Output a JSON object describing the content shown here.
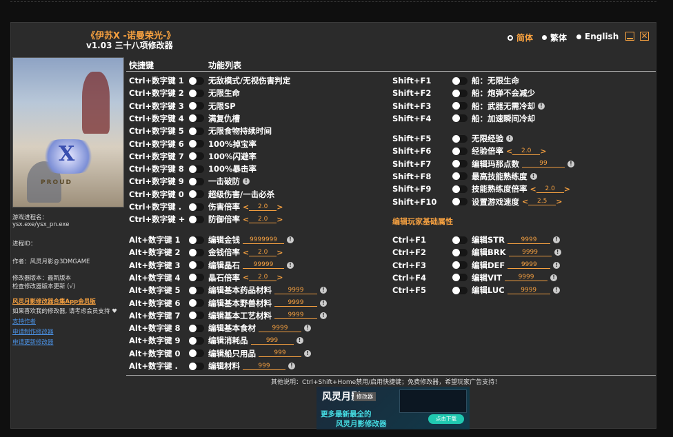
{
  "title": "《伊苏X -诺曼荣光-》",
  "subtitle": "v1.03 三十八项修改器",
  "languages": [
    {
      "label": "简体",
      "selected": true
    },
    {
      "label": "繁体",
      "selected": false
    },
    {
      "label": "English",
      "selected": false
    }
  ],
  "cover": {
    "logo_letter": "X",
    "logo_word": "PROUD"
  },
  "sidebar": {
    "process_label": "游戏进程名：",
    "process_value": "ysx.exe/ysx_pn.exe",
    "process_id": "进程ID：",
    "author": "作者：风灵月影@3DMGAME",
    "version": "修改器版本：最新版本",
    "check_update": "检查修改器版本更新 (√)",
    "app_link": "风灵月影修改器合集App会员版",
    "support_text": "如果喜欢我的修改器, 请考虑会员支持 ♥",
    "support_author": "支持作者",
    "request_trainer": "申请制作修改器",
    "request_update": "申请更新修改器"
  },
  "headers": {
    "hotkey": "快捷键",
    "features": "功能列表"
  },
  "left_options": [
    {
      "key": "Ctrl+数字键 1",
      "label": "无敌模式/无视伤害判定"
    },
    {
      "key": "Ctrl+数字键 2",
      "label": "无限生命"
    },
    {
      "key": "Ctrl+数字键 3",
      "label": "无限SP"
    },
    {
      "key": "Ctrl+数字键 4",
      "label": "满复仇槽"
    },
    {
      "key": "Ctrl+数字键 5",
      "label": "无限食物持续时间"
    },
    {
      "key": "Ctrl+数字键 6",
      "label": "100%掉宝率"
    },
    {
      "key": "Ctrl+数字键 7",
      "label": "100%闪避率"
    },
    {
      "key": "Ctrl+数字键 8",
      "label": "100%暴击率"
    },
    {
      "key": "Ctrl+数字键 9",
      "label": "一击破防",
      "info": true
    },
    {
      "key": "Ctrl+数字键 0",
      "label": "超级伤害/一击必杀"
    },
    {
      "key": "Ctrl+数字键 .",
      "label": "伤害倍率",
      "stepper": "2.0"
    },
    {
      "key": "Ctrl+数字键 +",
      "label": "防御倍率",
      "stepper": "2.0"
    },
    {
      "key": "Alt+数字键 1",
      "label": "编辑金钱",
      "input": "9999999",
      "info": true
    },
    {
      "key": "Alt+数字键 2",
      "label": "金钱倍率",
      "stepper": "2.0"
    },
    {
      "key": "Alt+数字键 3",
      "label": "编辑晶石",
      "input": "99999",
      "info": true
    },
    {
      "key": "Alt+数字键 4",
      "label": "晶石倍率",
      "stepper": "2.0"
    },
    {
      "key": "Alt+数字键 5",
      "label": "编辑基本药品材料",
      "input": "9999",
      "info": true
    },
    {
      "key": "Alt+数字键 6",
      "label": "编辑基本野兽材料",
      "input": "9999",
      "info": true
    },
    {
      "key": "Alt+数字键 7",
      "label": "编辑基本工艺材料",
      "input": "9999",
      "info": true
    },
    {
      "key": "Alt+数字键 8",
      "label": "编辑基本食材",
      "input": "9999",
      "info": true
    },
    {
      "key": "Alt+数字键 9",
      "label": "编辑消耗品",
      "input": "999",
      "info": true
    },
    {
      "key": "Alt+数字键 0",
      "label": "编辑船只用品",
      "input": "999",
      "info": true
    },
    {
      "key": "Alt+数字键 .",
      "label": "编辑材料",
      "input": "999",
      "info": true
    }
  ],
  "right_options": [
    {
      "key": "Shift+F1",
      "label": "船：无限生命"
    },
    {
      "key": "Shift+F2",
      "label": "船：炮弹不会减少"
    },
    {
      "key": "Shift+F3",
      "label": "船：武器无需冷却",
      "info": true
    },
    {
      "key": "Shift+F4",
      "label": "船：加速瞬间冷却"
    },
    {
      "key": "Shift+F5",
      "label": "无限经验",
      "info": true
    },
    {
      "key": "Shift+F6",
      "label": "经验倍率",
      "stepper": "2.0"
    },
    {
      "key": "Shift+F7",
      "label": "编辑玛那点数",
      "input": "99",
      "info": true
    },
    {
      "key": "Shift+F8",
      "label": "最高技能熟练度",
      "info": true
    },
    {
      "key": "Shift+F9",
      "label": "技能熟练度倍率",
      "stepper": "2.0"
    },
    {
      "key": "Shift+F10",
      "label": "设置游戏速度",
      "stepper": "2.5"
    }
  ],
  "section_title": "编辑玩家基础属性",
  "stat_options": [
    {
      "key": "Ctrl+F1",
      "label": "编辑STR",
      "input": "9999",
      "info": true
    },
    {
      "key": "Ctrl+F2",
      "label": "编辑BRK",
      "input": "9999",
      "info": true
    },
    {
      "key": "Ctrl+F3",
      "label": "编辑DEF",
      "input": "9999",
      "info": true
    },
    {
      "key": "Ctrl+F4",
      "label": "编辑VIT",
      "input": "9999",
      "info": true
    },
    {
      "key": "Ctrl+F5",
      "label": "编辑LUC",
      "input": "9999",
      "info": true
    }
  ],
  "footer": "其他说明：Ctrl+Shift+Home禁用/启用快捷键；免费修改器，希望玩家广告支持！",
  "ad": {
    "brand": "风灵月影",
    "tag": "修改器",
    "line1": "更多最新最全的",
    "line2": "风灵月影修改器",
    "download": "点击下载"
  },
  "colors": {
    "accent": "#f5a040",
    "panel": "#2b2b2b",
    "link": "#4a90e2"
  }
}
